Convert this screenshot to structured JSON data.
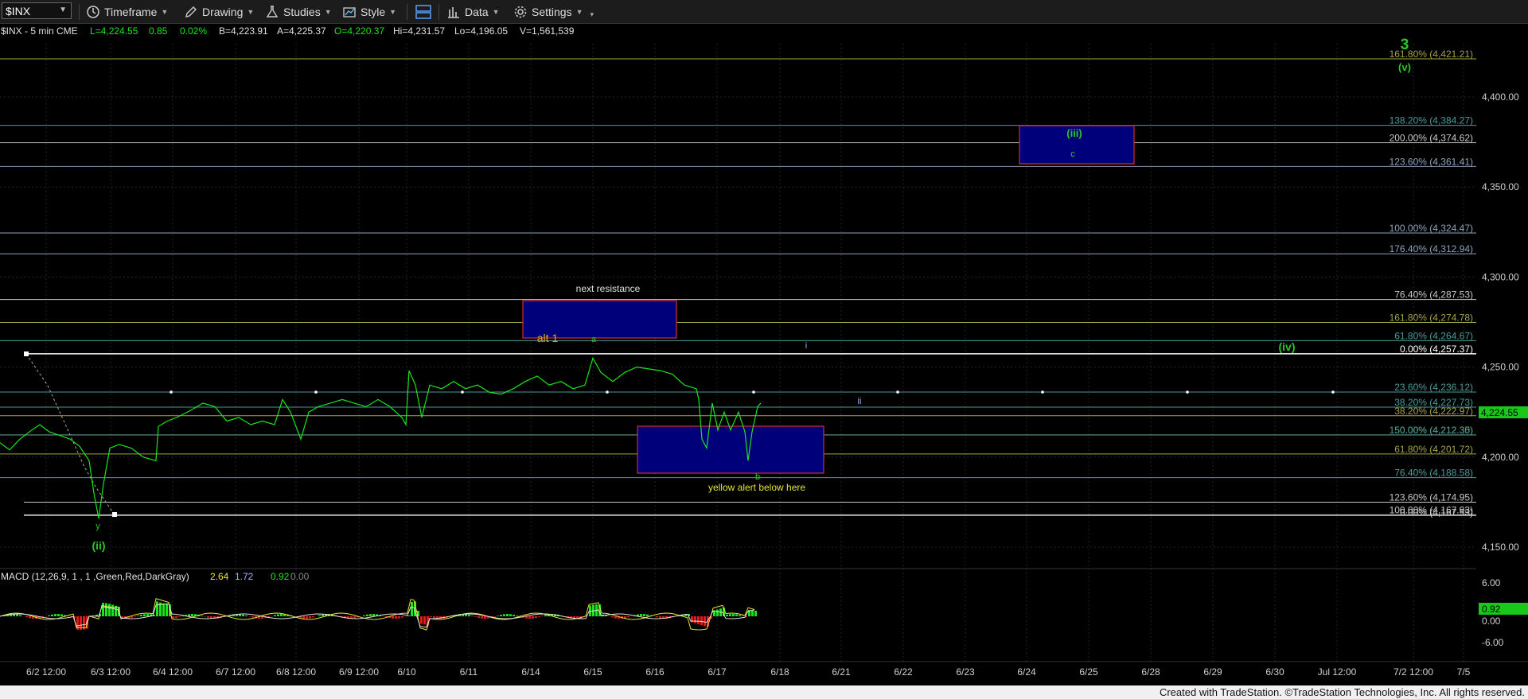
{
  "toolbar": {
    "symbol": "$INX",
    "timeframe": "Timeframe",
    "drawing": "Drawing",
    "studies": "Studies",
    "style": "Style",
    "data": "Data",
    "settings": "Settings"
  },
  "header": {
    "symbol_info": "$INX - 5 min  CME",
    "last": "L=4,224.55",
    "change": "0.85",
    "change_pct": "0.02%",
    "bid": "B=4,223.91",
    "ask": "A=4,225.37",
    "open": "O=4,220.37",
    "high": "Hi=4,231.57",
    "low": "Lo=4,196.05",
    "volume": "V=1,561,539"
  },
  "colors": {
    "price_line": "#19e619",
    "grid": "#1e2630",
    "axis_text": "#d0d0d0",
    "fib_blue": "#9db3c9",
    "fib_olive": "#a3a343",
    "fib_teal": "#4a9a9a",
    "fib_gray": "#b5b5b5",
    "box_fill": "#00007a",
    "box_border": "#d03030",
    "wave_green": "#28c828",
    "alert_yellow": "#e6e632",
    "orange": "#e6a81e"
  },
  "price_axis": {
    "ticks": [
      "4,400.00",
      "4,350.00",
      "4,300.00",
      "4,250.00",
      "4,200.00",
      "4,150.00"
    ],
    "tick_values": [
      4400,
      4350,
      4300,
      4250,
      4200,
      4150
    ],
    "last_badge": "4,224.55"
  },
  "time_axis": {
    "labels": [
      "6/2 12:00",
      "6/3 12:00",
      "6/4 12:00",
      "6/7 12:00",
      "6/8 12:00",
      "6/9 12:00",
      "6/10",
      "6/11",
      "6/14",
      "6/15",
      "6/16",
      "6/17",
      "6/18",
      "6/21",
      "6/22",
      "6/23",
      "6/24",
      "6/25",
      "6/28",
      "6/29",
      "6/30",
      "Jul 12:00",
      "7/2 12:00",
      "7/5"
    ]
  },
  "fib_levels": [
    {
      "label": "161.80% (4,421.21)",
      "value": 4421.21,
      "color": "olive"
    },
    {
      "label": "138.20% (4,384.27)",
      "value": 4384.27,
      "color": "teal"
    },
    {
      "label": "200.00% (4,374.62)",
      "value": 4374.62,
      "color": "gray"
    },
    {
      "label": "123.60% (4,361.41)",
      "value": 4361.41,
      "color": "blue"
    },
    {
      "label": "100.00% (4,324.47)",
      "value": 4324.47,
      "color": "blue"
    },
    {
      "label": "176.40% (4,312.94)",
      "value": 4312.94,
      "color": "blue"
    },
    {
      "label": "76.40% (4,287.53)",
      "value": 4287.53,
      "color": "gray"
    },
    {
      "label": "161.80% (4,274.78)",
      "value": 4274.78,
      "color": "olive"
    },
    {
      "label": "61.80% (4,264.67)",
      "value": 4264.67,
      "color": "teal"
    },
    {
      "label": "0.00% (4,257.37)",
      "value": 4257.37,
      "color": "white"
    },
    {
      "label": "23.60% (4,236.12)",
      "value": 4236.12,
      "color": "teal"
    },
    {
      "label": "38.20% (4,227.73)",
      "value": 4227.73,
      "color": "teal"
    },
    {
      "label": "38.20% (4,222.97)",
      "value": 4222.97,
      "color": "olive"
    },
    {
      "label": "50.00% (4,212.35)",
      "value": 4212.35,
      "color": "olive"
    },
    {
      "label": "150.00% (4,212.30)",
      "value": 4212.3,
      "color": "teal"
    },
    {
      "label": "61.80% (4,201.72)",
      "value": 4201.72,
      "color": "olive"
    },
    {
      "label": "76.40% (4,188.58)",
      "value": 4188.58,
      "color": "teal"
    },
    {
      "label": "123.60% (4,174.95)",
      "value": 4174.95,
      "color": "gray"
    },
    {
      "label": "100.00% (4,167.93)",
      "value": 4167.93,
      "color": "gray"
    },
    {
      "label": "0.00% (4,167.53)",
      "value": 4167.53,
      "color": "gray"
    }
  ],
  "annotations": {
    "wave_3": "3",
    "wave_v": "(v)",
    "wave_iii": "(iii)",
    "wave_c": "c",
    "next_resistance": "next resistance",
    "alt1": "alt 1",
    "wave_a": "a",
    "wave_i": "i",
    "wave_ii_small": "ii",
    "wave_iv": "(iv)",
    "wave_b": "b",
    "yellow_alert": "yellow alert below here",
    "wave_y": "y",
    "wave_ii": "(ii)"
  },
  "macd": {
    "label": "MACD (12,26,9, 1 , 1 ,Green,Red,DarkGray)",
    "v1": "2.64",
    "v2": "1.72",
    "v3": "0.92",
    "v4": "0.00",
    "ticks": [
      "6.00",
      "0.00",
      "-6.00"
    ],
    "badge": "0.92",
    "badge_top": "0.00"
  },
  "footer": "Created with TradeStation. ©TradeStation Technologies, Inc. All rights reserved."
}
